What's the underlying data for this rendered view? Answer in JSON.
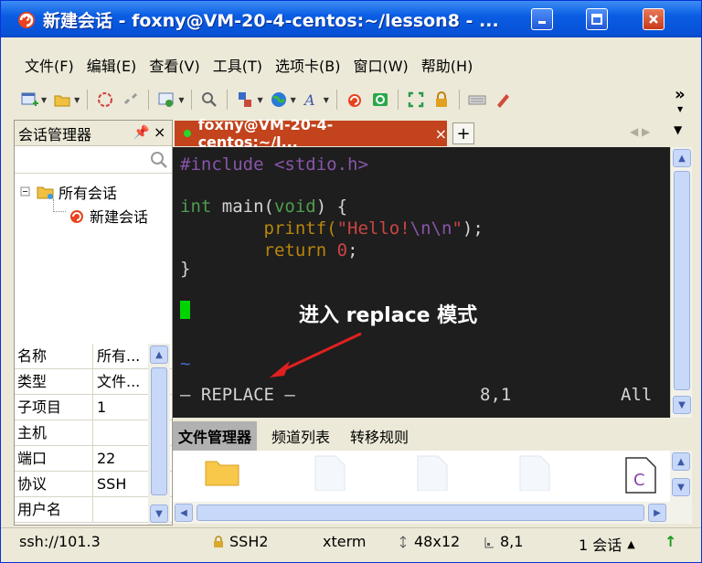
{
  "window": {
    "title": "新建会话 - foxny@VM-20-4-centos:~/lesson8 - ...",
    "buttons": {
      "minimize_icon": "minimize-icon",
      "maximize_icon": "maximize-icon",
      "close_icon": "close-icon"
    }
  },
  "menubar": {
    "items": [
      "文件(F)",
      "编辑(E)",
      "查看(V)",
      "工具(T)",
      "选项卡(B)",
      "窗口(W)",
      "帮助(H)"
    ]
  },
  "toolbar": {
    "icons": [
      "new-session-icon",
      "open-folder-icon",
      "reconnect-icon",
      "disconnect-icon",
      "session-options-icon",
      "find-icon",
      "transfer-icon",
      "globe-icon",
      "font-icon",
      "securefx-icon",
      "sftp-icon",
      "fullscreen-icon",
      "lock-icon",
      "keyboard-icon",
      "pen-icon"
    ],
    "overflow": "»"
  },
  "session_manager": {
    "title": "会话管理器",
    "pin": "ф",
    "close": "×",
    "tree": {
      "root": "所有会话",
      "child": "新建会话"
    },
    "properties": [
      {
        "key": "名称",
        "value": "所有..."
      },
      {
        "key": "类型",
        "value": "文件..."
      },
      {
        "key": "子项目",
        "value": "1"
      },
      {
        "key": "主机",
        "value": ""
      },
      {
        "key": "端口",
        "value": "22"
      },
      {
        "key": "协议",
        "value": "SSH"
      },
      {
        "key": "用户名",
        "value": ""
      }
    ]
  },
  "tabs": {
    "active_label": "foxny@VM-20-4-centos:~/l...",
    "close": "×",
    "add": "+"
  },
  "terminal": {
    "lines": {
      "l1_include": "#include",
      "l1_header": "<stdio.h>",
      "l3_int": "int",
      "l3_main": " main(",
      "l3_void": "void",
      "l3_rest": ") {",
      "l4_printf": "        printf(",
      "l4_str_open": "\"Hello!",
      "l4_escapes": "\\n\\n",
      "l4_str_close": "\"",
      "l4_rest": ");",
      "l5_return": "        return",
      "l5_zero": "0",
      "l5_semi": ";",
      "l6": "}",
      "tilde": "~",
      "status_mode": "— REPLACE —",
      "status_pos": "8,1",
      "status_all": "All"
    },
    "colors": {
      "keyword": "#b8860b",
      "type": "#4f9d4f",
      "string": "#cc4444",
      "text": "#d4d4d4",
      "preproc": "#8855aa",
      "bg": "#1e1e1e"
    },
    "annotation": "进入 replace 模式"
  },
  "file_manager": {
    "tabs": [
      "文件管理器",
      "频道列表",
      "转移规则"
    ]
  },
  "statusbar": {
    "address": "ssh://101.3",
    "protocol": "SSH2",
    "terminal": "xterm",
    "size": "48x12",
    "cursor": "8,1",
    "sessions": "1 会话"
  }
}
